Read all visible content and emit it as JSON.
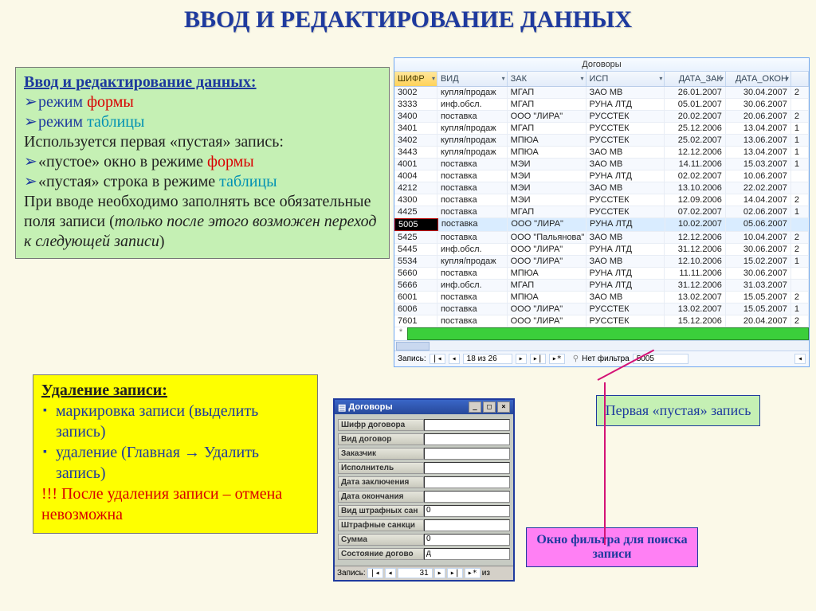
{
  "title": "ВВОД И РЕДАКТИРОВАНИЕ ДАННЫХ",
  "box1": {
    "header": "Ввод и редактирование данных:",
    "b1": "режим ",
    "b1r": "формы",
    "b2": "режим ",
    "b2t": "таблицы",
    "p1": "Используется первая «пустая» запись:",
    "b3": "«пустое» окно в режиме ",
    "b3r": "формы",
    "b4": "«пустая» строка в режиме ",
    "b4t": "таблицы",
    "p2a": "При вводе необходимо заполнять все обязательные поля записи (",
    "p2i": "только после этого возможен переход к следующей записи",
    "p2b": ")"
  },
  "box2": {
    "header": "Удаление записи:",
    "b1": "маркировка записи (выделить запись)",
    "b2a": "удаление (Главная ",
    "b2arrow": "→",
    "b2b": "  Удалить запись)",
    "warn": "!!! После удаления записи – отмена невозможна"
  },
  "callout_green": "Первая «пустая» запись",
  "callout_pink": "Окно фильтра для поиска записи",
  "dsheet": {
    "wintitle": "Договоры",
    "cols": [
      "ШИФР",
      "ВИД",
      "ЗАК",
      "ИСП",
      "ДАТА_ЗАК",
      "ДАТА_ОКОН"
    ],
    "rows": [
      [
        "3002",
        "купля/продаж",
        "МГАП",
        "ЗАО МВ",
        "26.01.2007",
        "30.04.2007",
        "2"
      ],
      [
        "3333",
        "инф.обсл.",
        "МГАП",
        "РУНА ЛТД",
        "05.01.2007",
        "30.06.2007",
        ""
      ],
      [
        "3400",
        "поставка",
        "ООО \"ЛИРА\"",
        "РУССТЕК",
        "20.02.2007",
        "20.06.2007",
        "2"
      ],
      [
        "3401",
        "купля/продаж",
        "МГАП",
        "РУССТЕК",
        "25.12.2006",
        "13.04.2007",
        "1"
      ],
      [
        "3402",
        "купля/продаж",
        "МПЮА",
        "РУССТЕК",
        "25.02.2007",
        "13.06.2007",
        "1"
      ],
      [
        "3443",
        "купля/продаж",
        "МПЮА",
        "ЗАО МВ",
        "12.12.2006",
        "13.04.2007",
        "1"
      ],
      [
        "4001",
        "поставка",
        "МЭИ",
        "ЗАО МВ",
        "14.11.2006",
        "15.03.2007",
        "1"
      ],
      [
        "4004",
        "поставка",
        "МЭИ",
        "РУНА ЛТД",
        "02.02.2007",
        "10.06.2007",
        ""
      ],
      [
        "4212",
        "поставка",
        "МЭИ",
        "ЗАО МВ",
        "13.10.2006",
        "22.02.2007",
        ""
      ],
      [
        "4300",
        "поставка",
        "МЭИ",
        "РУССТЕК",
        "12.09.2006",
        "14.04.2007",
        "2"
      ],
      [
        "4425",
        "поставка",
        "МГАП",
        "РУССТЕК",
        "07.02.2007",
        "02.06.2007",
        "1"
      ],
      [
        "5005",
        "поставка",
        "ООО \"ЛИРА\"",
        "РУНА ЛТД",
        "10.02.2007",
        "05.06.2007",
        ""
      ],
      [
        "5425",
        "поставка",
        "ООО \"Пальянова\"",
        "ЗАО МВ",
        "12.12.2006",
        "10.04.2007",
        "2"
      ],
      [
        "5445",
        "инф.обсл.",
        "ООО \"ЛИРА\"",
        "РУНА ЛТД",
        "31.12.2006",
        "30.06.2007",
        "2"
      ],
      [
        "5534",
        "купля/продаж",
        "ООО \"ЛИРА\"",
        "ЗАО МВ",
        "12.10.2006",
        "15.02.2007",
        "1"
      ],
      [
        "5660",
        "поставка",
        "МПЮА",
        "РУНА ЛТД",
        "11.11.2006",
        "30.06.2007",
        ""
      ],
      [
        "5666",
        "инф.обсл.",
        "МГАП",
        "РУНА ЛТД",
        "31.12.2006",
        "31.03.2007",
        ""
      ],
      [
        "6001",
        "поставка",
        "МПЮА",
        "ЗАО МВ",
        "13.02.2007",
        "15.05.2007",
        "2"
      ],
      [
        "6006",
        "поставка",
        "ООО \"ЛИРА\"",
        "РУССТЕК",
        "13.02.2007",
        "15.05.2007",
        "1"
      ],
      [
        "7601",
        "поставка",
        "ООО \"ЛИРА\"",
        "РУССТЕК",
        "15.12.2006",
        "20.04.2007",
        "2"
      ]
    ],
    "sel_index": 11,
    "nav_label": "Запись:",
    "nav_pos": "18 из 26",
    "filter_label": "Нет фильтра",
    "filter_value": "5005"
  },
  "form": {
    "title": "Договоры",
    "fields": [
      {
        "lbl": "Шифр договора",
        "val": ""
      },
      {
        "lbl": "Вид договор",
        "val": ""
      },
      {
        "lbl": "Заказчик",
        "val": ""
      },
      {
        "lbl": "Исполнитель",
        "val": ""
      },
      {
        "lbl": "Дата заключения",
        "val": ""
      },
      {
        "lbl": "Дата окончания",
        "val": ""
      },
      {
        "lbl": "Вид штрафных сан",
        "val": "0"
      },
      {
        "lbl": "Штрафные санкци",
        "val": ""
      },
      {
        "lbl": "Сумма",
        "val": "0"
      },
      {
        "lbl": "Состояние догово",
        "val": "д"
      }
    ],
    "nav_label": "Запись:",
    "nav_pos": "31",
    "nav_of": "из"
  }
}
